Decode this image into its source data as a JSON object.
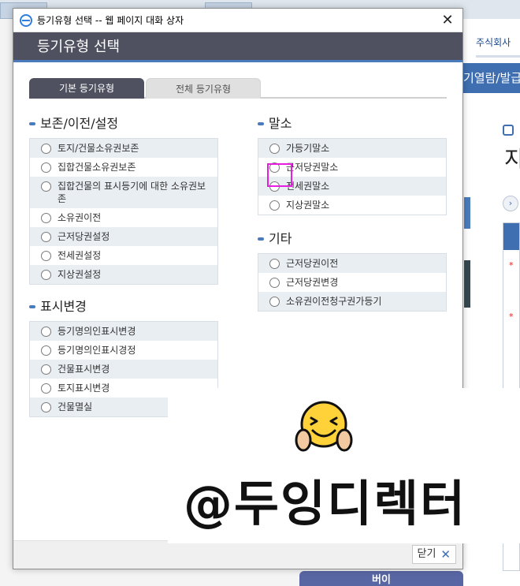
{
  "window": {
    "title": "등기유형 선택 -- 웹 페이지 대화 상자",
    "close_glyph": "✕"
  },
  "header": {
    "title": "등기유형 선택"
  },
  "tabs": [
    {
      "label": "기본 등기유형",
      "active": true
    },
    {
      "label": "전체 등기유형",
      "active": false
    }
  ],
  "sections": {
    "preserve": {
      "title": "보존/이전/설정",
      "items": [
        "토지/건물소유권보존",
        "집합건물소유권보존",
        "집합건물의 표시등기에 대한 소유권보존",
        "소유권이전",
        "근저당권설정",
        "전세권설정",
        "지상권설정"
      ]
    },
    "display": {
      "title": "표시변경",
      "items": [
        "등기명의인표시변경",
        "등기명의인표시경정",
        "건물표시변경",
        "토지표시변경",
        "건물멸실"
      ]
    },
    "cancel": {
      "title": "말소",
      "items": [
        "가등기말소",
        "근저당권말소",
        "전세권말소",
        "지상권말소"
      ]
    },
    "other": {
      "title": "기타",
      "items": [
        "근저당권이전",
        "근저당권변경",
        "소유권이전청구권가등기"
      ]
    }
  },
  "footer": {
    "close_label": "닫기",
    "close_icon": "✕"
  },
  "watermark": {
    "text": "@두잉디렉터"
  },
  "background": {
    "company": "주식회사",
    "nav": "기열람/발급",
    "big_char": "지",
    "bottom_button": "버이",
    "arrow": "›"
  },
  "colors": {
    "header": "#4f5160",
    "accent": "#4a7bbd",
    "highlight": "#e61ee0"
  }
}
